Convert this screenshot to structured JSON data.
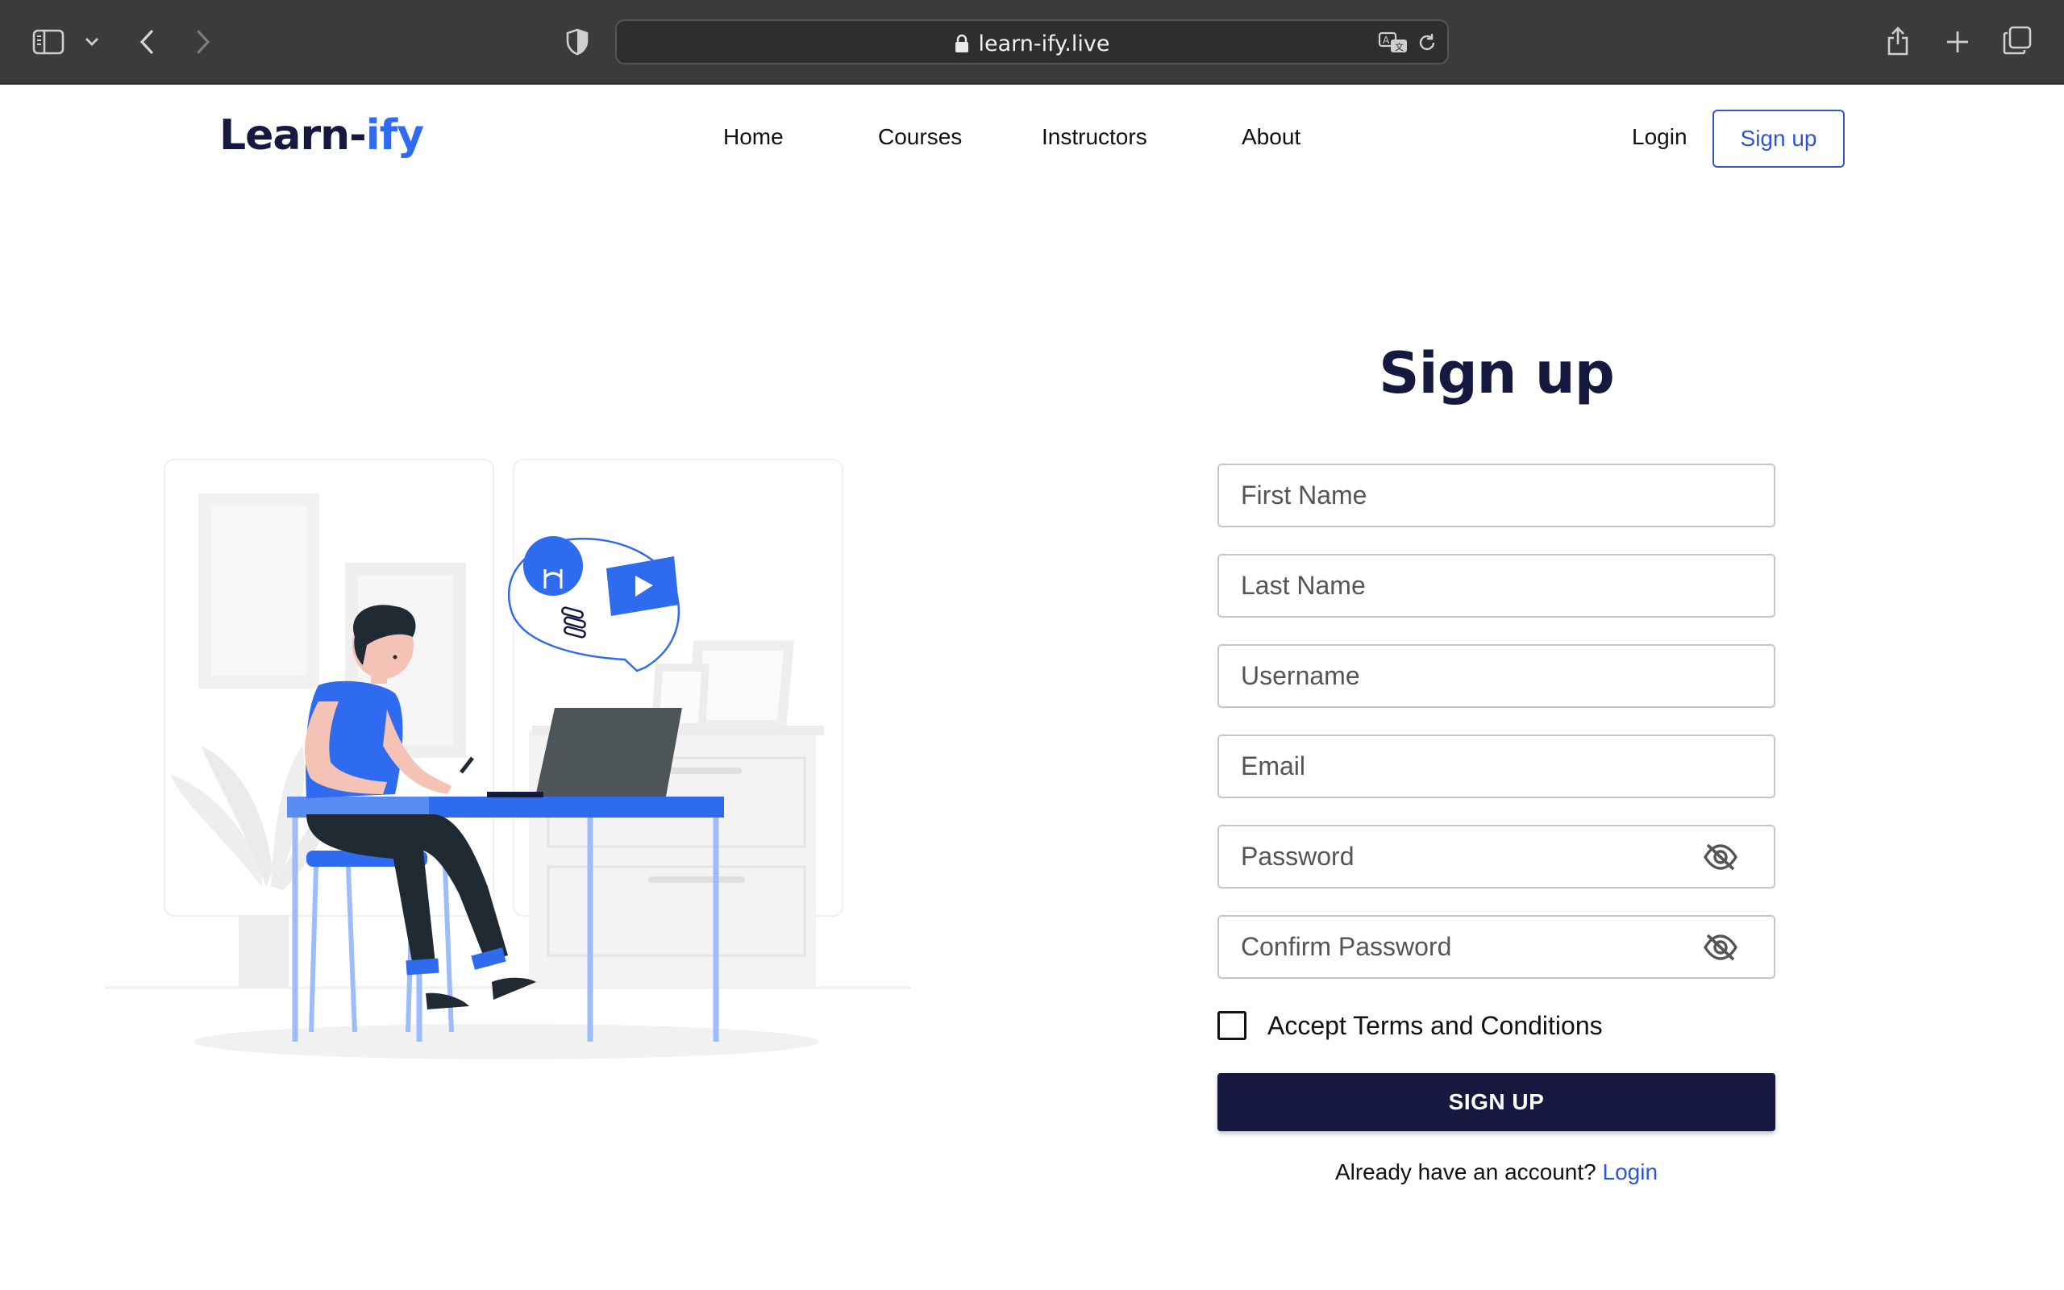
{
  "browser": {
    "url": "learn-ify.live"
  },
  "brand": {
    "name_main": "Learn-",
    "name_accent": "ify",
    "accent_color": "#2f6bef",
    "dark_color": "#16193f"
  },
  "nav": {
    "items": [
      {
        "label": "Home"
      },
      {
        "label": "Courses"
      },
      {
        "label": "Instructors"
      },
      {
        "label": "About"
      }
    ],
    "login_label": "Login",
    "signup_label": "Sign up"
  },
  "form": {
    "title": "Sign up",
    "fields": {
      "first_name": "First Name",
      "last_name": "Last Name",
      "username": "Username",
      "email": "Email",
      "password": "Password",
      "confirm_password": "Confirm Password"
    },
    "terms_label": "Accept Terms and Conditions",
    "terms_checked": false,
    "submit_label": "SIGN UP",
    "already_text": "Already have an account?",
    "login_link": "Login",
    "button_color": "#17183f",
    "link_color": "#2f54d6"
  },
  "icons": {
    "sidebar": "sidebar-icon",
    "back": "chevron-left-icon",
    "forward": "chevron-right-icon",
    "privacy": "shield-icon",
    "lock": "lock-icon",
    "translate": "translate-icon",
    "reload": "reload-icon",
    "share": "share-icon",
    "new_tab": "plus-icon",
    "tabs": "tabs-overview-icon",
    "visibility": "eye-off-icon"
  }
}
